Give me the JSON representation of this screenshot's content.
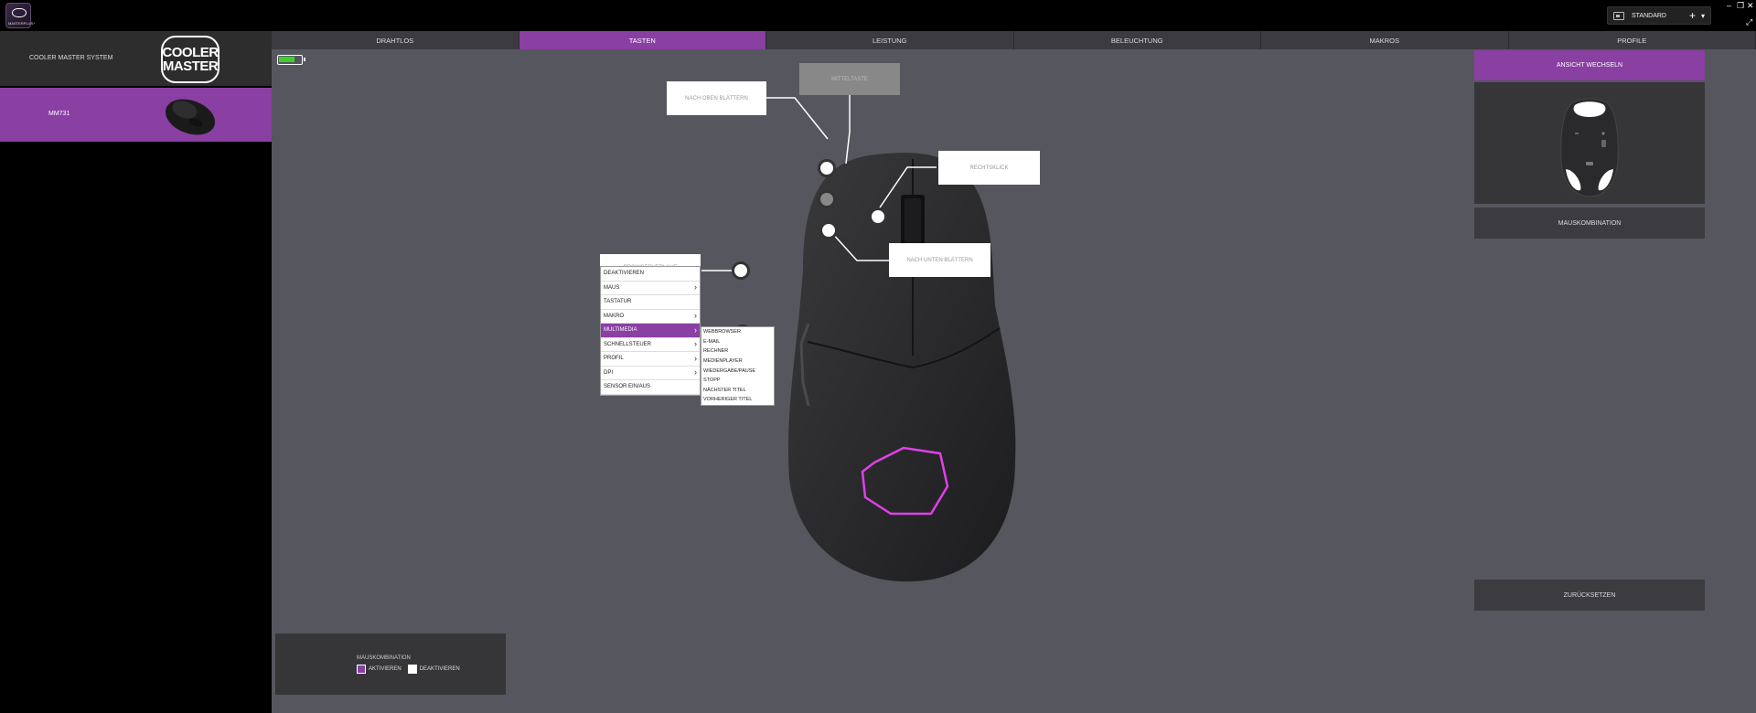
{
  "app": {
    "logo_text": "MASTERPLUS+",
    "profile": "STANDARD"
  },
  "sidebar": {
    "brand_label": "COOLER MASTER SYSTEM",
    "logo_lines": [
      "COOLER",
      "MASTER"
    ],
    "device_label": "MM731"
  },
  "tabs": [
    {
      "label": "DRAHTLOS"
    },
    {
      "label": "TASTEN"
    },
    {
      "label": "LEISTUNG"
    },
    {
      "label": "BELEUCHTUNG"
    },
    {
      "label": "MAKROS"
    },
    {
      "label": "PROFILE"
    }
  ],
  "battery": {
    "level_percent": 75,
    "color": "#3ed12c"
  },
  "callouts": {
    "scroll_up": "NACH OBEN BLÄTTERN",
    "middle": "MITTELTASTE",
    "right_click": "RECHTSKLICK",
    "scroll_down": "NACH UNTEN BLÄTTERN",
    "browser_back": "BROWSERVERLAUF"
  },
  "menu": {
    "items": [
      {
        "label": "DEAKTIVIEREN"
      },
      {
        "label": "MAUS"
      },
      {
        "label": "TASTATUR"
      },
      {
        "label": "MAKRO"
      },
      {
        "label": "MULTIMEDIA"
      },
      {
        "label": "SCHNELLSTEUER"
      },
      {
        "label": "PROFIL"
      },
      {
        "label": "DPI"
      },
      {
        "label": "SENSOR EIN/AUS"
      }
    ],
    "submenu": [
      "WEBBROWSER",
      "E-MAIL",
      "RECHNER",
      "MEDIENPLAYER",
      "WIEDERGABE/PAUSE",
      "STOPP",
      "NÄCHSTER TITEL",
      "VORHERIGER TITEL"
    ]
  },
  "right_panel": {
    "view_switch": "ANSICHT WECHSELN",
    "mouse_combo": "MAUSKOMBINATION",
    "reset": "ZURÜCKSETZEN"
  },
  "combo_panel": {
    "title": "MAUSKOMBINATION",
    "enable": "AKTIVIEREN",
    "disable": "DEAKTIVIEREN"
  },
  "colors": {
    "accent": "#8a3fa3",
    "logo_glow": "#e040e8"
  }
}
